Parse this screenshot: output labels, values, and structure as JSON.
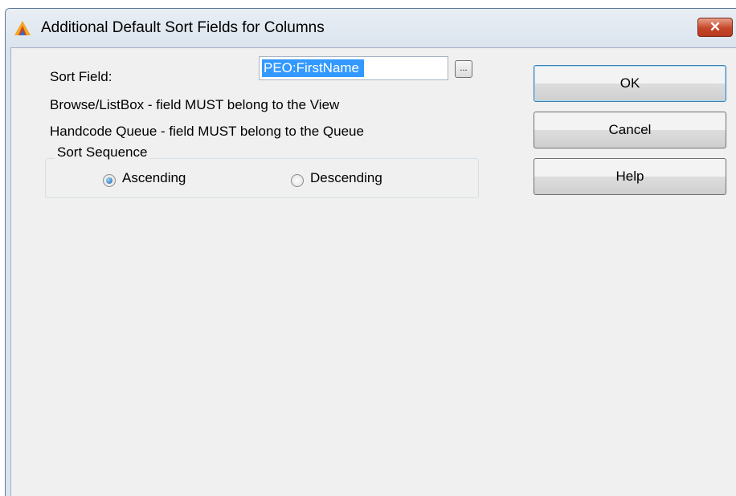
{
  "window": {
    "title": "Additional Default Sort Fields for Columns",
    "close_label": "✕"
  },
  "form": {
    "sort_field_label": "Sort Field:",
    "sort_field_value": "PEO:FirstName",
    "lookup_label": "...",
    "info_line_1": "Browse/ListBox - field MUST belong to the View",
    "info_line_2": "Handcode Queue - field MUST belong to the Queue",
    "sort_sequence": {
      "label": "Sort Sequence",
      "options": [
        {
          "label": "Ascending",
          "selected": true
        },
        {
          "label": "Descending",
          "selected": false
        }
      ]
    }
  },
  "buttons": {
    "ok": "OK",
    "cancel": "Cancel",
    "help": "Help"
  },
  "colors": {
    "selection": "#3399ff",
    "close_button": "#c6462a",
    "client_background": "#f0f0f0"
  }
}
